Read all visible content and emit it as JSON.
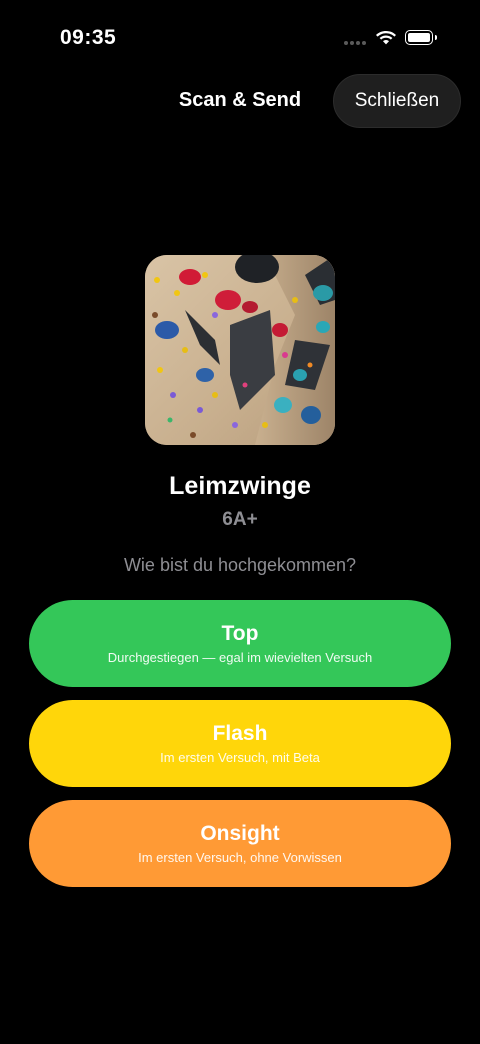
{
  "status_bar": {
    "time": "09:35",
    "icons": [
      "cellular-signal-icon",
      "wifi-icon",
      "battery-icon"
    ]
  },
  "header": {
    "title": "Scan & Send",
    "close_label": "Schließen"
  },
  "route": {
    "image": "climbing-wall-photo",
    "name": "Leimzwinge",
    "grade": "6A+"
  },
  "question": "Wie bist du hochgekommen?",
  "options": [
    {
      "label": "Top",
      "description": "Durchgestiegen — egal im wievielten Versuch",
      "color": "#34C759"
    },
    {
      "label": "Flash",
      "description": "Im ersten Versuch, mit Beta",
      "color": "#FFD60A"
    },
    {
      "label": "Onsight",
      "description": "Im ersten Versuch, ohne Vorwissen",
      "color": "#FF9A35"
    }
  ],
  "colors": {
    "background": "#000000",
    "secondary_text": "#8E8E93",
    "close_button_bg": "#1F1F1F"
  }
}
